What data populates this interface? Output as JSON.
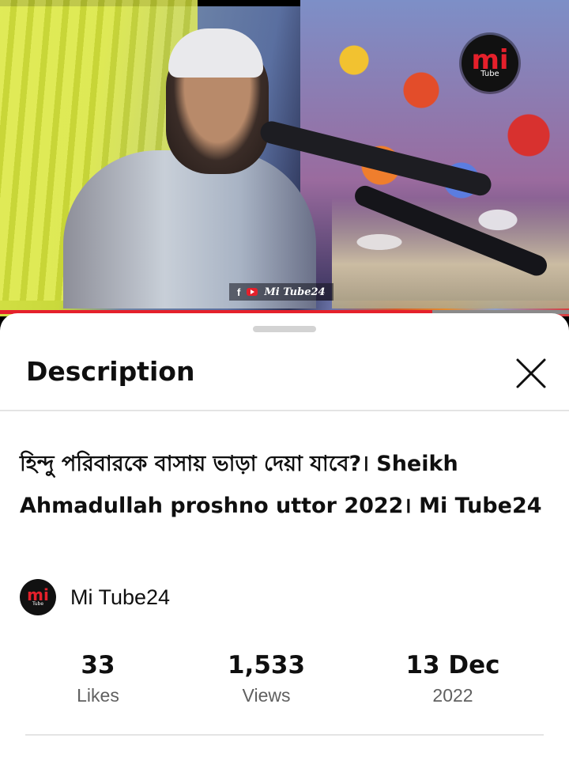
{
  "video": {
    "logo_text": "mi",
    "logo_subtext": "Tube",
    "watermark_fb": "f",
    "watermark_text": "Mi Tube24",
    "progress_fraction": 0.76,
    "accent_color": "#e5202b"
  },
  "description_panel": {
    "title": "Description",
    "close_icon": "close-icon"
  },
  "video_info": {
    "title": "হিন্দু পরিবারকে বাসায় ভাড়া দেয়া যাবে?। Sheikh Ahmadullah proshno uttor 2022। Mi Tube24",
    "channel_name": "Mi Tube24",
    "channel_avatar_text": "mi",
    "channel_avatar_subtext": "Tube"
  },
  "stats": {
    "likes_value": "33",
    "likes_label": "Likes",
    "views_value": "1,533",
    "views_label": "Views",
    "date_value": "13 Dec",
    "date_year": "2022"
  }
}
